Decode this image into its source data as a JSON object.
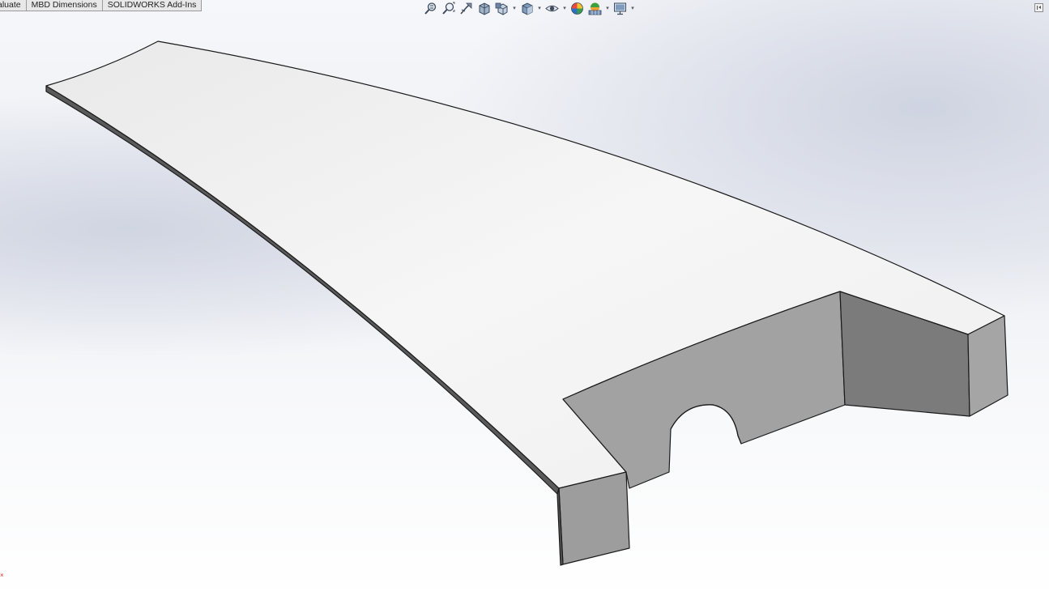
{
  "command_manager": {
    "tabs": [
      {
        "label": "aluate"
      },
      {
        "label": "MBD Dimensions"
      },
      {
        "label": "SOLIDWORKS Add-Ins"
      }
    ]
  },
  "heads_up_toolbar": {
    "icons": [
      "zoom-to-fit-icon",
      "zoom-to-area-icon",
      "previous-view-icon",
      "section-view-icon",
      "view-orientation-icon",
      "display-style-icon",
      "hide-show-items-icon",
      "edit-appearance-icon",
      "apply-scene-icon",
      "view-settings-icon"
    ]
  },
  "viewport": {
    "model": "sheet-metal-part",
    "colors": {
      "top_face": "#f1f1f1",
      "edge_dark": "#555555",
      "side_face": "#9c9c9c",
      "inner_face": "#7a7a7a",
      "outline": "#1a1a1a"
    },
    "origin_marker": "×"
  }
}
